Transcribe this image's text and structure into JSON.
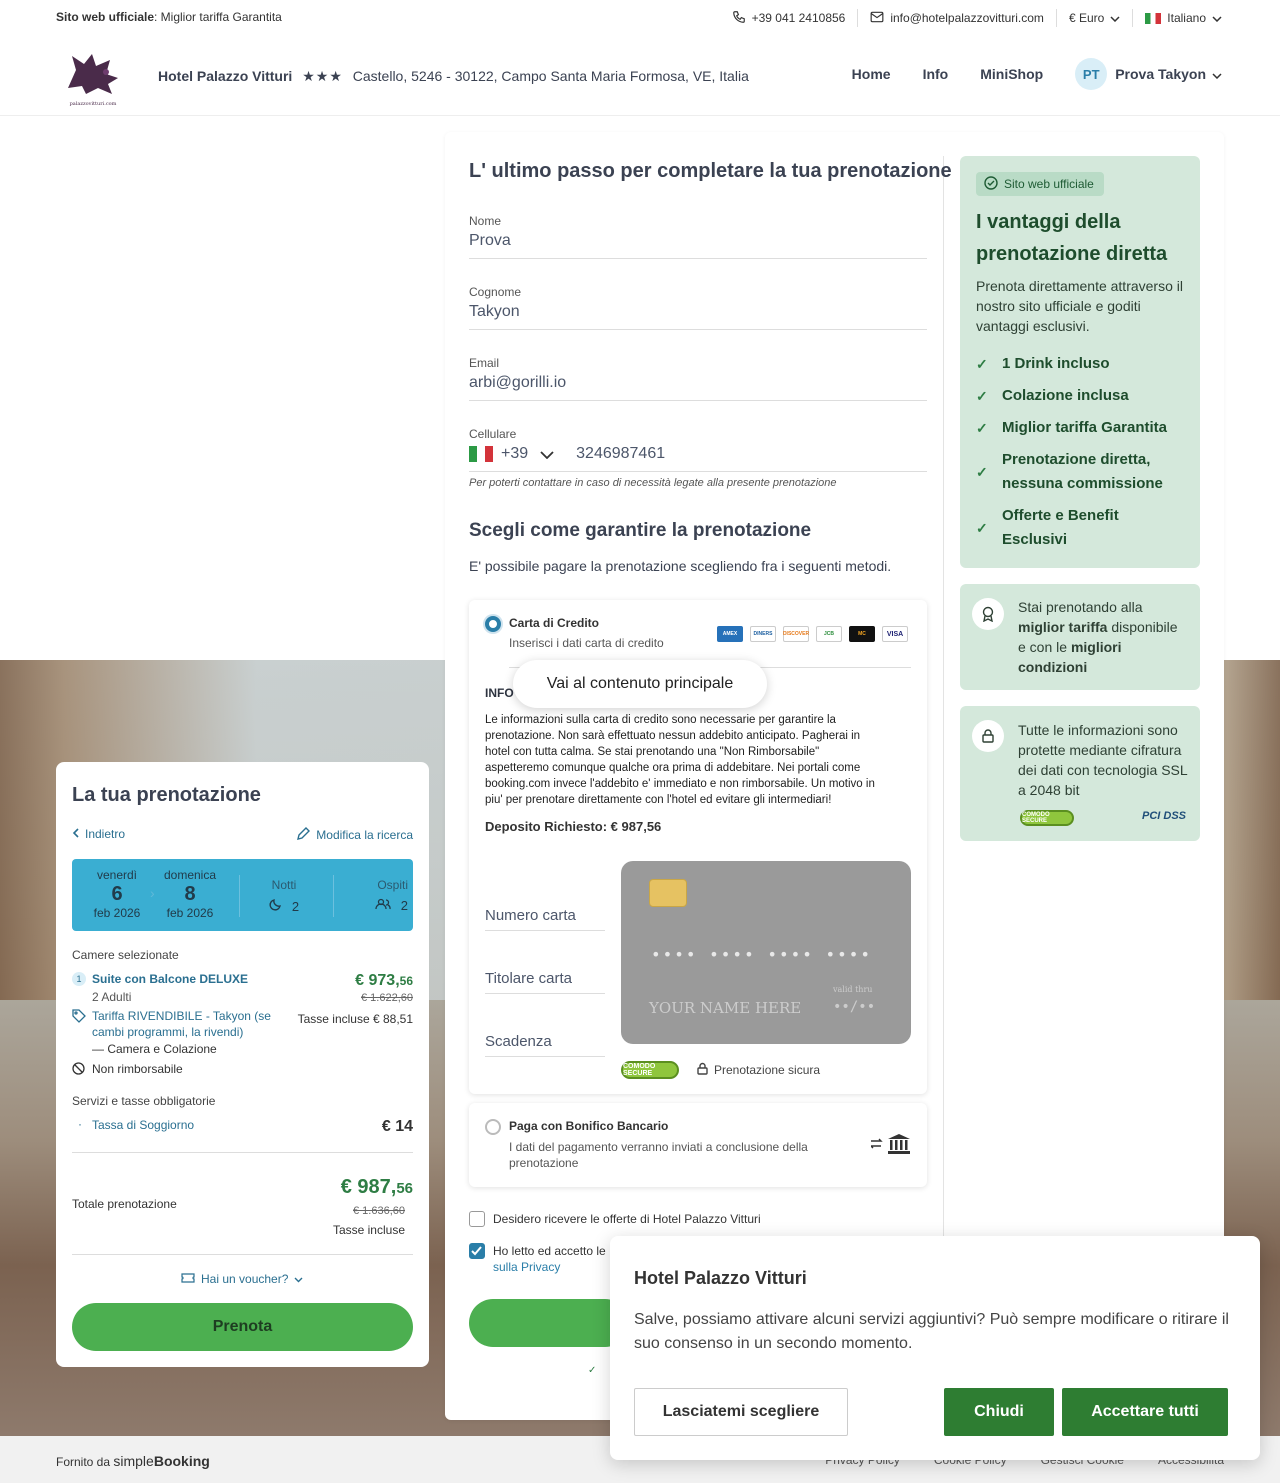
{
  "topbar": {
    "official_bold": "Sito web ufficiale",
    "official_rest": ": Miglior tariffa Garantita",
    "phone": "+39 041 2410856",
    "email": "info@hotelpalazzovitturi.com",
    "currency": "€ Euro",
    "language": "Italiano"
  },
  "header": {
    "logo_caption": "palazzovitturi.com",
    "hotel_name": "Hotel Palazzo Vitturi",
    "stars": "★★★",
    "address": "Castello, 5246 - 30122, Campo Santa Maria Formosa, VE, Italia",
    "nav": [
      "Home",
      "Info",
      "MiniShop"
    ],
    "avatar_initials": "PT",
    "user_name": "Prova Takyon"
  },
  "form": {
    "title": "L' ultimo passo per completare la tua prenotazione",
    "nome_label": "Nome",
    "nome_value": "Prova",
    "cognome_label": "Cognome",
    "cognome_value": "Takyon",
    "email_label": "Email",
    "email_value": "arbi@gorilli.io",
    "cell_label": "Cellulare",
    "cell_prefix": "+39",
    "cell_value": "3246987461",
    "cell_hint": "Per poterti contattare in caso di necessità legate alla presente prenotazione",
    "guarantee_title": "Scegli come garantire la prenotazione",
    "guarantee_desc": "E' possibile pagare la prenotazione scegliendo fra i seguenti metodi."
  },
  "payment": {
    "card_title": "Carta di Credito",
    "card_sub": "Inserisci i dati carta di credito",
    "card_brands": [
      "AMEX",
      "DINERS",
      "DISCOVER",
      "JCB",
      "MC",
      "VISA"
    ],
    "info_title": "INFO",
    "skip_link": "Vai al contenuto principale",
    "info_text": "Le informazioni sulla carta di credito sono necessarie per garantire la prenotazione. Non sarà effettuato nessun addebito anticipato. Pagherai in hotel con tutta calma. Se stai prenotando una \"Non Rimborsabile\" aspetteremo comunque qualche ora prima di addebitare. Nei portali come booking.com invece l'addebito e' immediato e non rimborsabile. Un motivo in piu' per prenotare direttamente con l'hotel ed evitare gli intermediari!",
    "deposit": "Deposito Richiesto: € 987,56",
    "placeholder_number": "Numero carta",
    "placeholder_holder": "Titolare carta",
    "placeholder_expiry": "Scadenza",
    "cc_number": "•••• •••• •••• ••••",
    "cc_name": "YOUR NAME HERE",
    "cc_valid": "valid thru",
    "cc_expiry": "••/••",
    "comodo": "COMODO SECURE",
    "secure_label": "Prenotazione sicura",
    "bonifico_title": "Paga con Bonifico Bancario",
    "bonifico_desc": "I dati del pagamento verranno inviati a conclusione della prenotazione"
  },
  "consents": {
    "offers": "Desidero ricevere le offerte di Hotel Palazzo Vitturi",
    "privacy_a": "Ho letto ed accetto le",
    "privacy_b": "sulla Privacy"
  },
  "benefits": {
    "badge": "Sito web ufficiale",
    "title": "I vantaggi della prenotazione diretta",
    "desc": "Prenota direttamente attraverso il nostro sito ufficiale e goditi vantaggi esclusivi.",
    "items": [
      "1 Drink incluso",
      "Colazione inclusa",
      "Miglior tariffa Garantita",
      "Prenotazione diretta, nessuna commissione",
      "Offerte e Benefit Esclusivi"
    ],
    "best_rate_1": "Stai prenotando alla ",
    "best_rate_b1": "miglior tariffa",
    "best_rate_2": " disponibile e con le ",
    "best_rate_b2": "migliori condizioni",
    "ssl": "Tutte le informazioni sono protette mediante cifratura dei dati con tecnologia SSL a 2048 bit",
    "pci": "PCI DSS"
  },
  "summary": {
    "title": "La tua prenotazione",
    "back": "Indietro",
    "edit": "Modifica la ricerca",
    "checkin_day": "venerdì",
    "checkin_num": "6",
    "checkin_month": "feb 2026",
    "checkout_day": "domenica",
    "checkout_num": "8",
    "checkout_month": "feb 2026",
    "nights_label": "Notti",
    "nights": "2",
    "guests_label": "Ospiti",
    "guests": "2",
    "rooms_label": "Camere selezionate",
    "room_index": "1",
    "room_name": "Suite con Balcone DELUXE",
    "room_price_int": "€ 973,",
    "room_price_dec": "56",
    "room_price_old": "€ 1.622,60",
    "room_guests": "2 Adulti",
    "room_taxes": "Tasse incluse € 88,51",
    "rate_name": "Tariffa RIVENDIBILE - Takyon (se cambi programmi, la rivendi)",
    "board": "Camera e Colazione",
    "non_refundable": "Non rimborsabile",
    "services_label": "Servizi e tasse obbligatorie",
    "tax_name": "Tassa di Soggiorno",
    "tax_price": "€ 14",
    "total_label": "Totale prenotazione",
    "total_int": "€ 987,",
    "total_dec": "56",
    "total_old": "€ 1.636,60",
    "total_taxes": "Tasse incluse",
    "voucher": "Hai un voucher?",
    "book": "Prenota"
  },
  "cookie": {
    "title": "Hotel Palazzo Vitturi",
    "text": "Salve, possiamo attivare alcuni servizi aggiuntivi? Può sempre modificare o ritirare il suo consenso in un secondo momento.",
    "choose": "Lasciatemi scegliere",
    "close": "Chiudi",
    "accept": "Accettare tutti"
  },
  "footer": {
    "powered": "Fornito da ",
    "brand_a": "simple",
    "brand_b": "Booking",
    "links": [
      "Privacy Policy",
      "Cookie Policy",
      "Gestisci Cookie",
      "Accessibilità"
    ]
  },
  "colors": {
    "accent": "#2a7ea8",
    "green": "#4caf50",
    "dark_green": "#2e7d32",
    "benefit_bg": "#d4e8db"
  }
}
